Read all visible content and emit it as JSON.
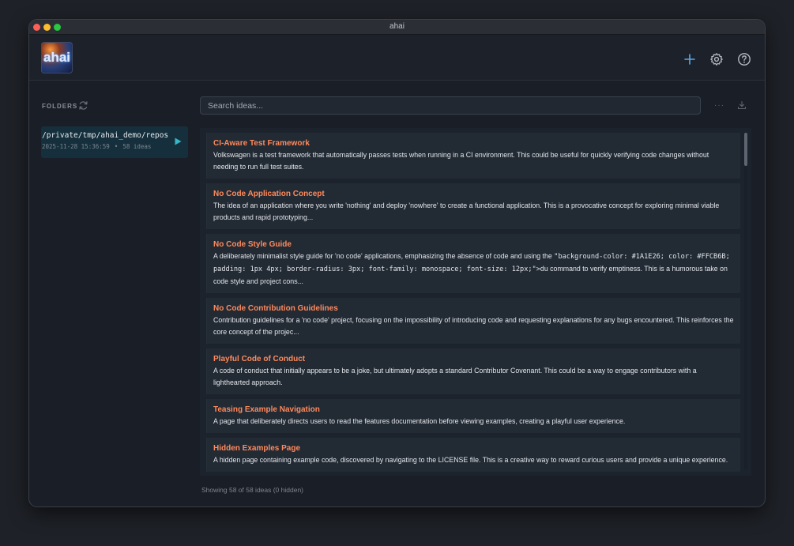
{
  "window": {
    "title": "ahai"
  },
  "header": {
    "logo_text": "ahai",
    "icons": [
      "plus-icon",
      "gear-icon",
      "help-icon"
    ],
    "accent_color": "#5aa9e6"
  },
  "sidebar": {
    "folders_label": "FOLDERS",
    "folders": [
      {
        "path": "/private/tmp/ahai_demo/repos",
        "timestamp": "2025-11-28 15:36:59",
        "separator": "•",
        "count": "58 ideas"
      }
    ]
  },
  "search": {
    "placeholder": "Search ideas...",
    "value": ""
  },
  "toolbar": {
    "more_label": "···"
  },
  "ideas": [
    {
      "title": "CI-Aware Test Framework",
      "description": "Volkswagen is a test framework that automatically passes tests when running in a CI environment. This could be useful for quickly verifying code changes without needing to run full test suites."
    },
    {
      "title": "No Code Application Concept",
      "description": "The idea of an application where you write 'nothing' and deploy 'nowhere' to create a functional application. This is a provocative concept for exploring minimal viable products and rapid prototyping..."
    },
    {
      "title": "No Code Style Guide",
      "description_before": "A deliberately minimalist style guide for 'no code' applications, emphasizing the absence of code and using the",
      "description_code": "\"background-color: #1A1E26; color: #FFCB6B; padding: 1px 4px; border-radius: 3px; font-family: monospace; font-size: 12px;\">",
      "description_after": "du command to verify emptiness. This is a humorous take on code style and project cons..."
    },
    {
      "title": "No Code Contribution Guidelines",
      "description": "Contribution guidelines for a 'no code' project, focusing on the impossibility of introducing code and requesting explanations for any bugs encountered. This reinforces the core concept of the projec..."
    },
    {
      "title": "Playful Code of Conduct",
      "description": "A code of conduct that initially appears to be a joke, but ultimately adopts a standard Contributor Covenant. This could be a way to engage contributors with a lighthearted approach."
    },
    {
      "title": "Teasing Example Navigation",
      "description": "A page that deliberately directs users to read the features documentation before viewing examples, creating a playful user experience."
    },
    {
      "title": "Hidden Examples Page",
      "description": "A hidden page containing example code, discovered by navigating to the LICENSE file. This is a creative way to reward curious users and provide a unique experience."
    }
  ],
  "status": {
    "text": "Showing 58 of 58 ideas (0 hidden)"
  },
  "colors": {
    "title_accent": "#ff8a5c",
    "folder_selected_bg": "#15303c",
    "play_icon": "#37b6c8"
  }
}
